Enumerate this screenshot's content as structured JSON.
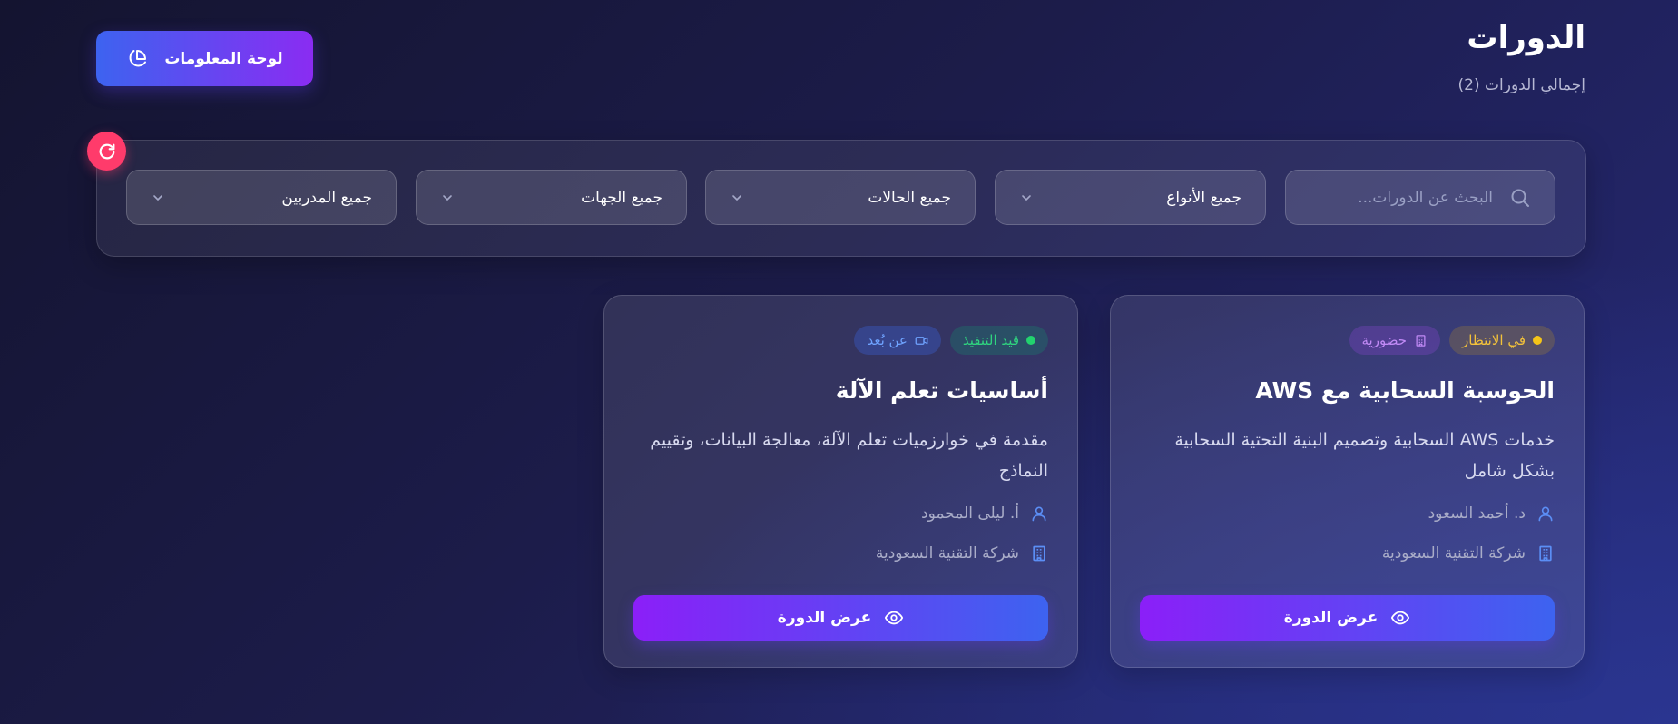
{
  "header": {
    "title": "الدورات",
    "subtitle": "إجمالي الدورات (2)",
    "dashboard_label": "لوحة المعلومات"
  },
  "filters": {
    "search_placeholder": "البحث عن الدورات...",
    "types_label": "جميع الأنواع",
    "statuses_label": "جميع الحالات",
    "entities_label": "جميع الجهات",
    "trainers_label": "جميع المدربين"
  },
  "courses": [
    {
      "status": "في الانتظار",
      "mode": "حضورية",
      "title": "الحوسبة السحابية مع AWS",
      "description": "خدمات AWS السحابية وتصميم البنية التحتية السحابية بشكل شامل",
      "instructor": "د. أحمد السعود",
      "company": "شركة التقنية السعودية",
      "view_label": "عرض الدورة"
    },
    {
      "status": "قيد التنفيذ",
      "mode": "عن بُعد",
      "title": "أساسيات تعلم الآلة",
      "description": "مقدمة في خوارزميات تعلم الآلة، معالجة البيانات، وتقييم النماذج",
      "instructor": "أ. ليلى المحمود",
      "company": "شركة التقنية السعودية",
      "view_label": "عرض الدورة"
    }
  ],
  "colors": {
    "accent_start": "#3d63f0",
    "accent_end": "#8a2cf2",
    "reset": "#ff3b6b",
    "pending": "#f5c518",
    "in_progress": "#22d36e",
    "icon_blue": "#5b8ef5"
  }
}
